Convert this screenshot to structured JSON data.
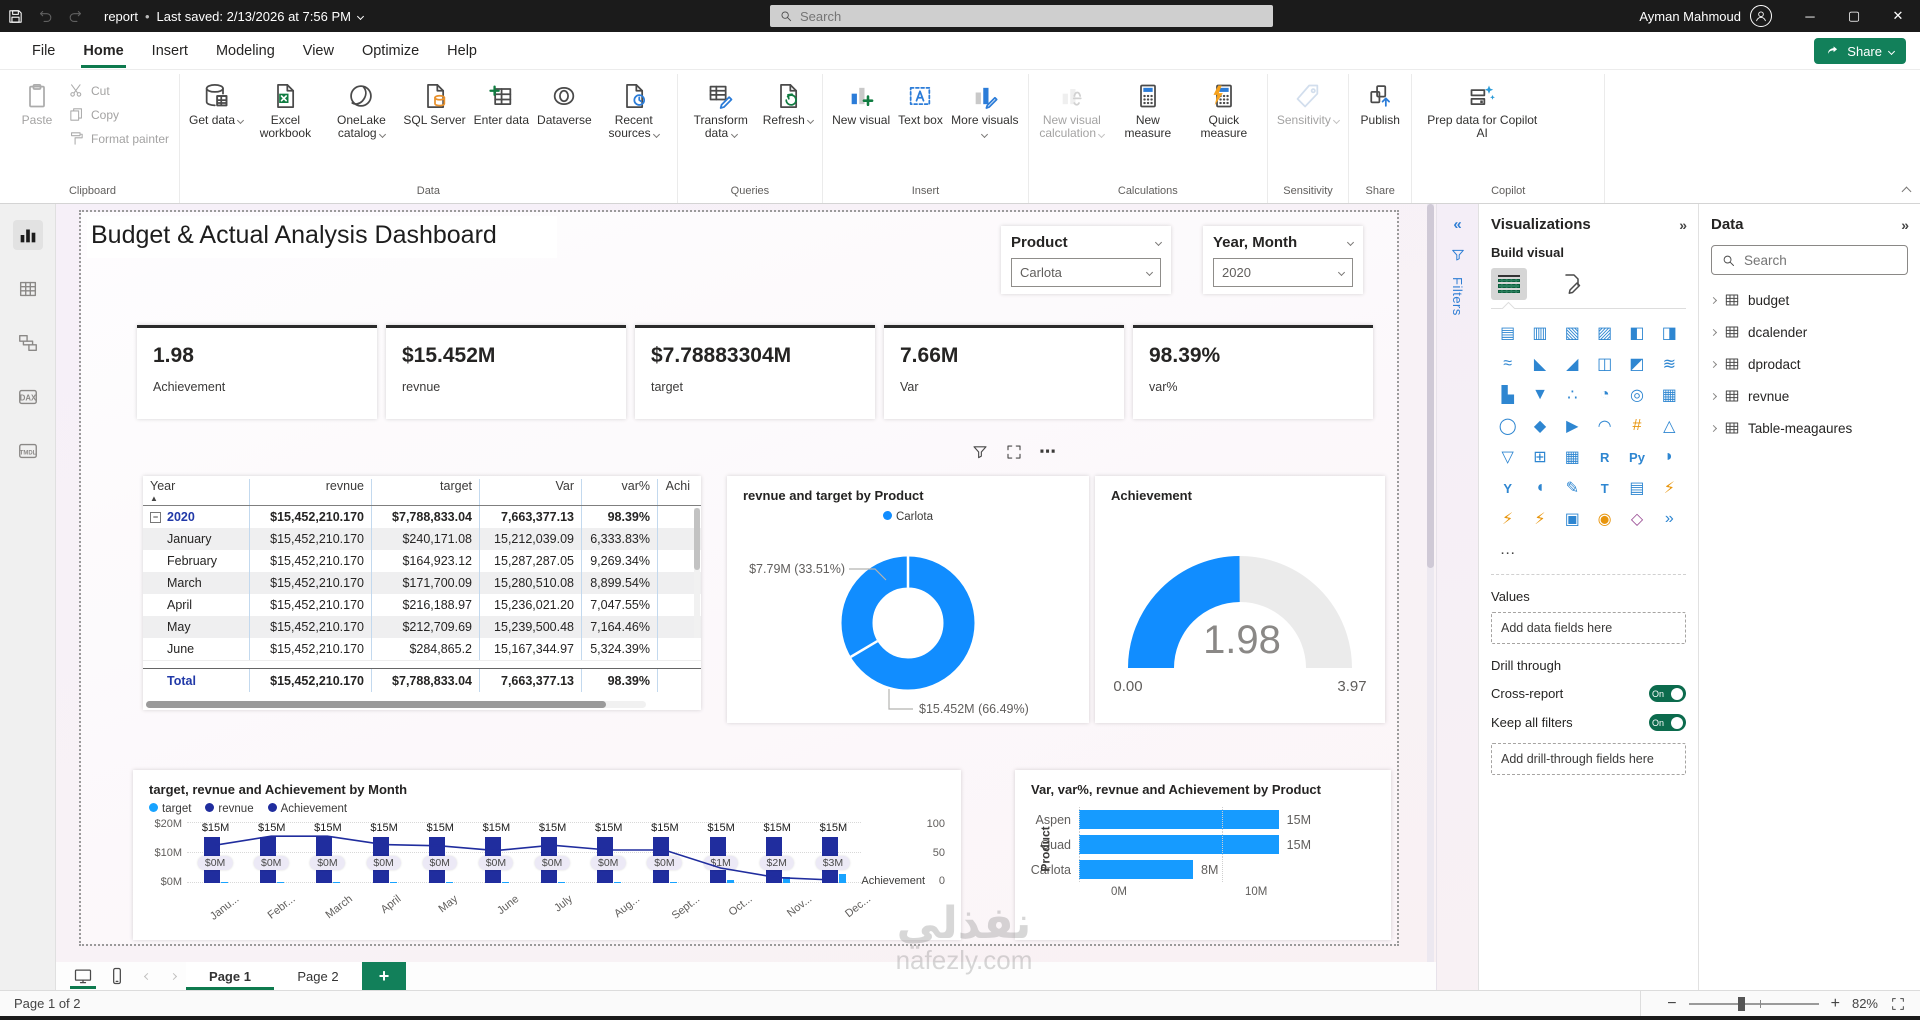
{
  "titlebar": {
    "doc": "report",
    "saved": "Last saved: 2/13/2026 at 7:56 PM",
    "search_placeholder": "Search",
    "user": "Ayman Mahmoud"
  },
  "menubar": {
    "tabs": [
      "File",
      "Home",
      "Insert",
      "Modeling",
      "View",
      "Optimize",
      "Help"
    ],
    "active_index": 1,
    "share_label": "Share"
  },
  "ribbon": {
    "groups": [
      {
        "label": "Clipboard",
        "items": [
          {
            "label": "Paste",
            "icon": "paste-icon",
            "big": true,
            "disabled": true
          },
          {
            "label": "Cut",
            "icon": "cut-icon",
            "small": true,
            "disabled": true
          },
          {
            "label": "Copy",
            "icon": "copy-icon",
            "small": true,
            "disabled": true
          },
          {
            "label": "Format painter",
            "icon": "format-painter-icon",
            "small": true,
            "disabled": true
          }
        ]
      },
      {
        "label": "Data",
        "items": [
          {
            "label": "Get data",
            "icon": "get-data-icon",
            "caret": true
          },
          {
            "label": "Excel workbook",
            "icon": "excel-workbook-icon"
          },
          {
            "label": "OneLake catalog",
            "icon": "onelake-catalog-icon",
            "caret": true
          },
          {
            "label": "SQL Server",
            "icon": "sql-server-icon"
          },
          {
            "label": "Enter data",
            "icon": "enter-data-icon"
          },
          {
            "label": "Dataverse",
            "icon": "dataverse-icon"
          },
          {
            "label": "Recent sources",
            "icon": "recent-sources-icon",
            "caret": true
          }
        ]
      },
      {
        "label": "Queries",
        "items": [
          {
            "label": "Transform data",
            "icon": "transform-data-icon",
            "caret": true
          },
          {
            "label": "Refresh",
            "icon": "refresh-icon",
            "caret": true
          }
        ]
      },
      {
        "label": "Insert",
        "items": [
          {
            "label": "New visual",
            "icon": "new-visual-icon"
          },
          {
            "label": "Text box",
            "icon": "text-box-icon"
          },
          {
            "label": "More visuals",
            "icon": "more-visuals-icon",
            "caret": true
          }
        ]
      },
      {
        "label": "Calculations",
        "items": [
          {
            "label": "New visual calculation",
            "icon": "new-visual-calculation-icon",
            "caret": true,
            "disabled": true
          },
          {
            "label": "New measure",
            "icon": "new-measure-icon"
          },
          {
            "label": "Quick measure",
            "icon": "quick-measure-icon"
          }
        ]
      },
      {
        "label": "Sensitivity",
        "items": [
          {
            "label": "Sensitivity",
            "icon": "sensitivity-icon",
            "caret": true,
            "disabled": true
          }
        ]
      },
      {
        "label": "Share",
        "items": [
          {
            "label": "Publish",
            "icon": "publish-icon"
          }
        ]
      },
      {
        "label": "Copilot",
        "items": [
          {
            "label": "Prep data for Copilot AI",
            "icon": "prep-data-copilot-icon",
            "wide": true
          },
          {
            "label": "",
            "icon": "copilot-icon"
          }
        ]
      }
    ]
  },
  "sidebar": {
    "items": [
      {
        "name": "report-view",
        "active": true
      },
      {
        "name": "table-view",
        "active": false
      },
      {
        "name": "model-view",
        "active": false
      },
      {
        "name": "dax-query-view",
        "active": false
      },
      {
        "name": "tmdl-view",
        "active": false
      }
    ]
  },
  "canvas": {
    "page_title": "Budget & Actual Analysis Dashboard",
    "slicers": [
      {
        "label": "Product",
        "value": "Carlota"
      },
      {
        "label": "Year, Month",
        "value": "2020"
      }
    ],
    "kpis": [
      {
        "value": "1.98",
        "label": "Achievement"
      },
      {
        "value": "$15.452M",
        "label": "revnue"
      },
      {
        "value": "$7.78883304M",
        "label": "target"
      },
      {
        "value": "7.66M",
        "label": "Var"
      },
      {
        "value": "98.39%",
        "label": "var%"
      }
    ],
    "table": {
      "headers": [
        "Year",
        "revnue",
        "target",
        "Var",
        "var%",
        "Achi"
      ],
      "rows": [
        {
          "label": "2020",
          "year": true,
          "cells": [
            "$15,452,210.170",
            "$7,788,833.04",
            "7,663,377.13",
            "98.39%"
          ]
        },
        {
          "label": "January",
          "cells": [
            "$15,452,210.170",
            "$240,171.08",
            "15,212,039.09",
            "6,333.83%"
          ]
        },
        {
          "label": "February",
          "cells": [
            "$15,452,210.170",
            "$164,923.12",
            "15,287,287.05",
            "9,269.34%"
          ]
        },
        {
          "label": "March",
          "cells": [
            "$15,452,210.170",
            "$171,700.09",
            "15,280,510.08",
            "8,899.54%"
          ]
        },
        {
          "label": "April",
          "cells": [
            "$15,452,210.170",
            "$216,188.97",
            "15,236,021.20",
            "7,047.55%"
          ]
        },
        {
          "label": "May",
          "cells": [
            "$15,452,210.170",
            "$212,709.69",
            "15,239,500.48",
            "7,164.46%"
          ]
        },
        {
          "label": "June",
          "cells": [
            "$15,452,210.170",
            "$284,865.2",
            "15,167,344.97",
            "5,324.39%"
          ]
        }
      ],
      "total": {
        "label": "Total",
        "cells": [
          "$15,452,210.170",
          "$7,788,833.04",
          "7,663,377.13",
          "98.39%"
        ]
      }
    },
    "donut": {
      "title": "revnue and target by Product",
      "legend": "Carlota",
      "label_small": "$7.79M (33.51%)",
      "label_big": "$15.452M (66.49%)",
      "big_pct": 66.49
    },
    "gauge": {
      "title": "Achievement",
      "value": "1.98",
      "min": "0.00",
      "max": "3.97",
      "pct": 49.87
    },
    "combo": {
      "title": "target, revnue and Achievement by Month",
      "legend": [
        {
          "label": "target",
          "color": "#18A3FF"
        },
        {
          "label": "revnue",
          "color": "#202D9E"
        },
        {
          "label": "Achievement",
          "color": "#202D9E"
        }
      ],
      "y_ticks": [
        "$20M",
        "$10M",
        "$0M"
      ],
      "y2_ticks": [
        "100",
        "50",
        "0"
      ],
      "y2_label": "Achievement",
      "months": [
        {
          "x": "Janu...",
          "bar": "$15M",
          "pill": "$0M",
          "ach": 63
        },
        {
          "x": "Febr...",
          "bar": "$15M",
          "pill": "$0M",
          "ach": 78
        },
        {
          "x": "March",
          "bar": "$15M",
          "pill": "$0M",
          "ach": 78
        },
        {
          "x": "April",
          "bar": "$15M",
          "pill": "$0M",
          "ach": 64
        },
        {
          "x": "May",
          "bar": "$15M",
          "pill": "$0M",
          "ach": 62
        },
        {
          "x": "June",
          "bar": "$15M",
          "pill": "$0M",
          "ach": 54
        },
        {
          "x": "July",
          "bar": "$15M",
          "pill": "$0M",
          "ach": 63
        },
        {
          "x": "Aug...",
          "bar": "$15M",
          "pill": "$0M",
          "ach": 55
        },
        {
          "x": "Sept...",
          "bar": "$15M",
          "pill": "$0M",
          "ach": 55
        },
        {
          "x": "Oct...",
          "bar": "$15M",
          "pill": "$1M",
          "ach": 25
        },
        {
          "x": "Nov...",
          "bar": "$15M",
          "pill": "$2M",
          "ach": 9
        },
        {
          "x": "Dec...",
          "bar": "$15M",
          "pill": "$3M",
          "ach": 5
        }
      ]
    },
    "product_bars": {
      "title": "Var, var%, revnue and Achievement by Product",
      "y_label": "Product",
      "bars": [
        {
          "label": "Aspen",
          "value": "15M",
          "frac": 1.0
        },
        {
          "label": "Quad",
          "value": "15M",
          "frac": 1.0
        },
        {
          "label": "Carlota",
          "value": "8M",
          "frac": 0.53
        }
      ],
      "x_ticks": [
        "0M",
        "10M"
      ]
    }
  },
  "filters_pane": {
    "label": "Filters"
  },
  "viz_panel": {
    "title": "Visualizations",
    "build_label": "Build visual",
    "icons": [
      {
        "n": "stacked-bar-chart-icon",
        "g": "▤"
      },
      {
        "n": "stacked-column-chart-icon",
        "g": "▥"
      },
      {
        "n": "clustered-bar-chart-icon",
        "g": "▧"
      },
      {
        "n": "clustered-column-chart-icon",
        "g": "▨"
      },
      {
        "n": "100-stacked-bar-chart-icon",
        "g": "◧"
      },
      {
        "n": "100-stacked-column-chart-icon",
        "g": "◨"
      },
      {
        "n": "line-chart-icon",
        "g": "≈"
      },
      {
        "n": "area-chart-icon",
        "g": "◣"
      },
      {
        "n": "stacked-area-chart-icon",
        "g": "◢"
      },
      {
        "n": "line-and-stacked-column-chart-icon",
        "g": "◫"
      },
      {
        "n": "line-and-clustered-column-chart-icon",
        "g": "◩"
      },
      {
        "n": "ribbon-chart-icon",
        "g": "≋"
      },
      {
        "n": "waterfall-chart-icon",
        "g": "▙"
      },
      {
        "n": "funnel-chart-icon",
        "g": "▼"
      },
      {
        "n": "scatter-chart-icon",
        "g": "∴"
      },
      {
        "n": "pie-chart-icon",
        "g": "◔"
      },
      {
        "n": "donut-chart-icon",
        "g": "◎"
      },
      {
        "n": "treemap-icon",
        "g": "▦"
      },
      {
        "n": "map-icon",
        "g": "◯"
      },
      {
        "n": "filled-map-icon",
        "g": "◆"
      },
      {
        "n": "azure-map-icon",
        "g": "▶"
      },
      {
        "n": "gauge-icon",
        "g": "◠"
      },
      {
        "n": "card-icon",
        "g": "#",
        "c": "#e8950c"
      },
      {
        "n": "kpi-icon",
        "g": "△"
      },
      {
        "n": "slicer-icon",
        "g": "▽"
      },
      {
        "n": "table-icon",
        "g": "⊞"
      },
      {
        "n": "matrix-icon",
        "g": "▦"
      },
      {
        "n": "r-script-icon",
        "g": "R",
        "txt": true
      },
      {
        "n": "python-icon",
        "g": "Py",
        "txt": true
      },
      {
        "n": "key-influencers-icon",
        "g": "◗"
      },
      {
        "n": "decomposition-tree-icon",
        "g": "Y",
        "txt": true
      },
      {
        "n": "qa-icon",
        "g": "◖"
      },
      {
        "n": "smart-narrative-icon",
        "g": "✎"
      },
      {
        "n": "metrics-icon",
        "g": "T",
        "txt": true
      },
      {
        "n": "paginated-report-icon",
        "g": "▤"
      },
      {
        "n": "power-apps-icon",
        "g": "⚡",
        "c": "#e8950c"
      },
      {
        "n": "power-automate-icon",
        "g": "⚡",
        "c": "#e8950c"
      },
      {
        "n": "power-script-icon",
        "g": "⚡",
        "c": "#e8950c"
      },
      {
        "n": "image-icon",
        "g": "▣"
      },
      {
        "n": "arcgis-map-icon",
        "g": "◉",
        "c": "#e8950c"
      },
      {
        "n": "html-content-icon",
        "g": "◇",
        "c": "#9B4F96"
      },
      {
        "n": "more-visuals-arrow-icon",
        "g": "»"
      },
      {
        "n": "get-more-visuals-ellipsis",
        "g": "…",
        "c": "#444"
      }
    ],
    "values_label": "Values",
    "values_placeholder": "Add data fields here",
    "drill_label": "Drill through",
    "cross_report": "Cross-report",
    "keep_filters": "Keep all filters",
    "toggle_on": "On",
    "drill_placeholder": "Add drill-through fields here"
  },
  "data_panel": {
    "title": "Data",
    "search_placeholder": "Search",
    "fields": [
      "budget",
      "dcalender",
      "dprodact",
      "revnue",
      "Table-meagaures"
    ]
  },
  "pagebar": {
    "pages": [
      "Page 1",
      "Page 2"
    ],
    "active_index": 0
  },
  "statusbar": {
    "left": "Page 1 of 2",
    "zoom": "82%"
  },
  "watermark": {
    "line1": "نفذلي",
    "line2": "nafezly.com"
  },
  "chart_data": [
    {
      "type": "pie",
      "title": "revnue and target by Product",
      "legend": [
        "Carlota"
      ],
      "labels": [
        "revnue",
        "target"
      ],
      "values": [
        15.452,
        7.79
      ],
      "percents": [
        66.49,
        33.51
      ],
      "unit": "$M",
      "color": "#118DFF"
    },
    {
      "type": "gauge",
      "title": "Achievement",
      "value": 1.98,
      "min": 0.0,
      "max": 3.97
    },
    {
      "type": "bar",
      "title": "target, revnue and Achievement by Month",
      "categories": [
        "January",
        "February",
        "March",
        "April",
        "May",
        "June",
        "July",
        "August",
        "September",
        "October",
        "November",
        "December"
      ],
      "series": [
        {
          "name": "revnue",
          "values": [
            15,
            15,
            15,
            15,
            15,
            15,
            15,
            15,
            15,
            15,
            15,
            15
          ],
          "unit": "$M"
        },
        {
          "name": "target",
          "values": [
            0,
            0,
            0,
            0,
            0,
            0,
            0,
            0,
            0,
            1,
            2,
            3
          ],
          "unit": "$M"
        },
        {
          "name": "Achievement",
          "axis": "secondary",
          "values": [
            63,
            78,
            78,
            64,
            62,
            54,
            63,
            55,
            55,
            25,
            9,
            5
          ]
        }
      ],
      "ylim": [
        0,
        20
      ],
      "y2lim": [
        0,
        100
      ],
      "grid": true,
      "legend_position": "top"
    },
    {
      "type": "bar",
      "orientation": "horizontal",
      "title": "Var, var%, revnue and Achievement by Product",
      "categories": [
        "Aspen",
        "Quad",
        "Carlota"
      ],
      "values": [
        15,
        15,
        8
      ],
      "unit": "M",
      "xlabel": "",
      "ylabel": "Product",
      "xlim": [
        0,
        15
      ],
      "x_ticks": [
        "0M",
        "10M"
      ]
    }
  ]
}
